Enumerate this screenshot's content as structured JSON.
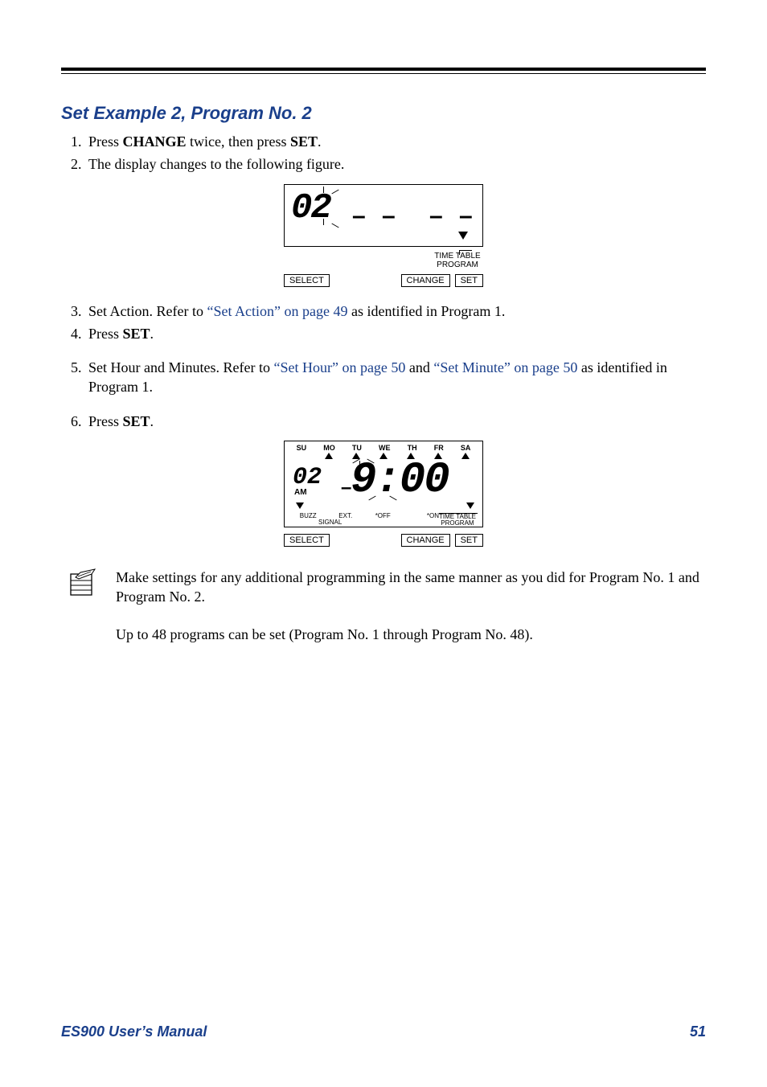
{
  "section_title": "Set Example 2, Program No. 2",
  "steps": {
    "s1_pre": "Press ",
    "s1_b1": "CHANGE",
    "s1_mid": " twice, then press ",
    "s1_b2": "SET",
    "s1_end": ".",
    "s2": "The display changes to the following figure.",
    "s3_pre": "Set Action. Refer to ",
    "s3_link": "“Set Action” on page 49",
    "s3_post": " as identified in Program 1.",
    "s4_pre": "Press ",
    "s4_b": "SET",
    "s4_end": ".",
    "s5_pre": "Set Hour and Minutes. Refer to ",
    "s5_link1": "“Set Hour” on page 50",
    "s5_mid": " and ",
    "s5_link2": "“Set Minute” on page 50",
    "s5_post": " as identified in Program 1.",
    "s6_pre": "Press ",
    "s6_b": "SET",
    "s6_end": "."
  },
  "fig1": {
    "seg": "02",
    "tt1": "TIME TABLE",
    "tt2": "PROGRAM",
    "btn_select": "SELECT",
    "btn_change": "CHANGE",
    "btn_set": "SET"
  },
  "fig2": {
    "days": [
      "SU",
      "MO",
      "TU",
      "WE",
      "TH",
      "FR",
      "SA"
    ],
    "seg": "02",
    "am": "AM",
    "time": "9:00",
    "buzz": "BUZZ",
    "ext_signal_top": "EXT.",
    "ext_signal_bot": "SIGNAL",
    "off": "*OFF",
    "on": "*ON",
    "tt1": "TIME TABLE",
    "tt2": "PROGRAM",
    "btn_select": "SELECT",
    "btn_change": "CHANGE",
    "btn_set": "SET"
  },
  "note": {
    "p1": "Make settings for any additional programming in the same manner as you did for Program No. 1 and Program No. 2.",
    "p2": "Up to 48 programs can be set (Program No. 1 through Program No. 48)."
  },
  "footer": {
    "left": "ES900 User’s Manual",
    "right": "51"
  }
}
